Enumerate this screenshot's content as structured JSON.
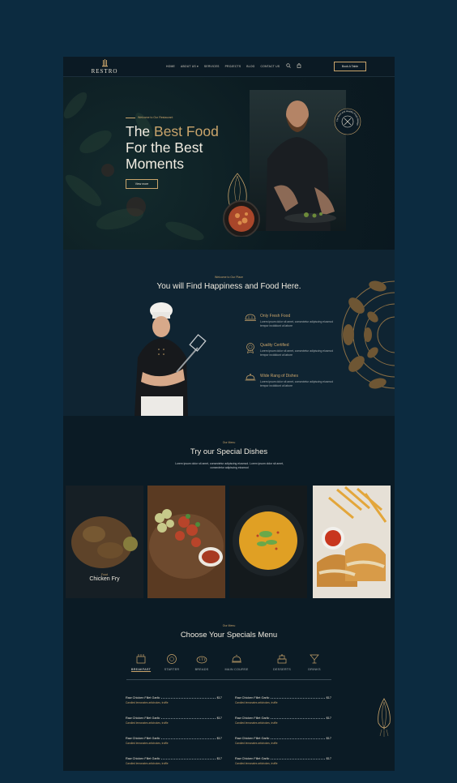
{
  "header": {
    "logo_text": "RESTRO",
    "nav": [
      "HOME",
      "ABOUT US ▾",
      "SERVICES",
      "PROJECTS",
      "BLOG",
      "CONTACT US"
    ],
    "book_button": "Book A Table"
  },
  "hero": {
    "eyebrow": "Welcome to Our Restaurant",
    "title_line1_plain": "The ",
    "title_line1_accent": "Best Food",
    "title_line2": "For the Best",
    "title_line3": "Moments",
    "button": "View more",
    "badge_text": "The Best and Healthy Food Always"
  },
  "about": {
    "eyebrow": "Welcome to Our Place",
    "title": "You will Find Happiness and Food Here.",
    "features": [
      {
        "icon": "bread-icon",
        "title": "Only Fresh Food",
        "text": "Lorem ipsum dolor sit amet, consectetur adipiscing eiusmod tempor incididunt ut labore"
      },
      {
        "icon": "certificate-icon",
        "title": "Quality Certified",
        "text": "Lorem ipsum dolor sit amet, consectetur adipiscing eiusmod tempor incididunt ut labore"
      },
      {
        "icon": "serving-dish-icon",
        "title": "Wide Rang of Dishes",
        "text": "Lorem ipsum dolor sit amet, consectetur adipiscing eiusmod tempor incididunt ut labore"
      }
    ]
  },
  "dishes": {
    "eyebrow": "Our Menu",
    "title": "Try our Special Dishes",
    "description": "Lorem ipsum dolor sit amet, consectetur adipiscing eiusmod. Lorem ipsum dolor sit amet, consectetur adipiscing eiusmod",
    "cards": [
      {
        "small": "Food",
        "big": "Chicken Fry"
      }
    ]
  },
  "menu": {
    "eyebrow": "Our Menu",
    "title": "Choose Your Specials Menu",
    "categories": [
      "BREAKFAST",
      "STARTER",
      "BREADS",
      "MAIN COURSE",
      "DESSERTS",
      "DRINKS"
    ],
    "items": [
      {
        "name": "Raw Chicken Fillet Garlic",
        "price": "$17",
        "desc": "Candied lemonates artichokes, truffle"
      },
      {
        "name": "Raw Chicken Fillet Garlic",
        "price": "$17",
        "desc": "Candied lemonates artichokes, truffle"
      },
      {
        "name": "Raw Chicken Fillet Garlic",
        "price": "$17",
        "desc": "Candied lemonates artichokes, truffle"
      },
      {
        "name": "Raw Chicken Fillet Garlic",
        "price": "$17",
        "desc": "Candied lemonates artichokes, truffle"
      },
      {
        "name": "Raw Chicken Fillet Garlic",
        "price": "$17",
        "desc": "Candied lemonates artichokes, truffle"
      },
      {
        "name": "Raw Chicken Fillet Garlic",
        "price": "$17",
        "desc": "Candied lemonates artichokes, truffle"
      },
      {
        "name": "Raw Chicken Fillet Garlic",
        "price": "$17",
        "desc": "Candied lemonates artichokes, truffle"
      },
      {
        "name": "Raw Chicken Fillet Garlic",
        "price": "$17",
        "desc": "Candied lemonates artichokes, truffle"
      }
    ]
  },
  "colors": {
    "outer_bg": "#0c2b40",
    "page_bg": "#0b1a24",
    "gold": "#c9a46b",
    "text": "#f0ebe0"
  }
}
